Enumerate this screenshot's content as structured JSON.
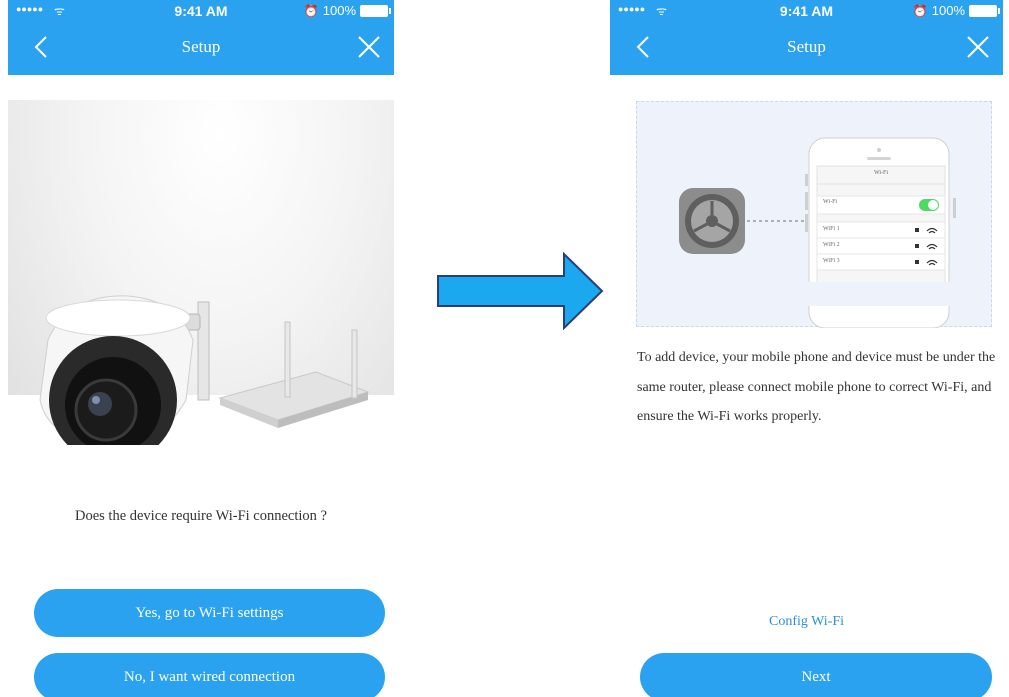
{
  "status_bar": {
    "signal": "●●●●●",
    "wifi": "ᯤ",
    "time": "9:41 AM",
    "battery_text": "100%"
  },
  "left_screen": {
    "title": "Setup",
    "question": "Does the device require Wi-Fi connection ?",
    "primary_button": "Yes, go to Wi-Fi settings",
    "secondary_button": "No, I want wired connection"
  },
  "right_screen": {
    "title": "Setup",
    "instructions": "To add device, your mobile phone and device must be under the same router, please connect mobile phone to correct Wi-Fi, and ensure the Wi-Fi works properly.",
    "config_link": "Config Wi-Fi",
    "next_button": "Next",
    "phone_illustration": {
      "header": "Wi-Fi",
      "toggle_label": "Wi-Fi",
      "toggle_on": true,
      "networks": [
        "WiFi 1",
        "WiFi 2",
        "WiFi 3"
      ]
    }
  },
  "colors": {
    "accent": "#2aa2f0",
    "toggle": "#4cd964",
    "arrow_fill": "#1ba8ee",
    "arrow_stroke": "#2a3f77"
  }
}
